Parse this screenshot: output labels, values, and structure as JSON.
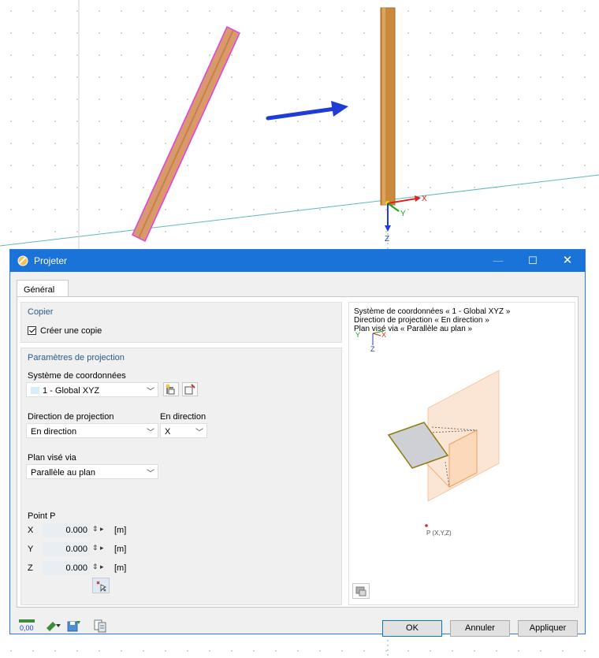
{
  "viewport": {
    "axis_labels": {
      "x": "X",
      "y": "Y",
      "z": "Z"
    },
    "colors": {
      "member": "#c98a3c",
      "arrow": "#1f3cd6",
      "selection": "#e040e0",
      "axis_line": "#4fb3b3"
    }
  },
  "dialog": {
    "title": "Projeter",
    "window_controls": {
      "minimize": "—",
      "maximize": "☐",
      "close": "✕"
    },
    "tabs": [
      {
        "label": "Général"
      }
    ],
    "copy_section": {
      "title": "Copier",
      "create_copy_label": "Créer une copie",
      "create_copy_checked": true
    },
    "projection_section": {
      "title": "Paramètres de projection",
      "coord_system_label": "Système de coordonnées",
      "coord_system_value": "1 - Global XYZ",
      "direction_label": "Direction de projection",
      "direction_value": "En direction",
      "in_direction_label": "En direction",
      "in_direction_value": "X",
      "target_plane_label": "Plan visé via",
      "target_plane_value": "Parallèle au plan",
      "point_label": "Point P",
      "coords": [
        {
          "axis": "X",
          "value": "0.000",
          "unit": "[m]"
        },
        {
          "axis": "Y",
          "value": "0.000",
          "unit": "[m]"
        },
        {
          "axis": "Z",
          "value": "0.000",
          "unit": "[m]"
        }
      ]
    },
    "preview": {
      "line1": "Système de coordonnées « 1 - Global XYZ »",
      "line2": "Direction de projection « En direction »",
      "line3": "Plan visé via « Parallèle au plan »",
      "point_label": "P (X,Y,Z)",
      "axis_y": "Y",
      "axis_x": "X",
      "axis_z": "Z"
    },
    "footer": {
      "decimal_icon_text": "0,00",
      "ok_label": "OK",
      "cancel_label": "Annuler",
      "apply_label": "Appliquer"
    }
  }
}
